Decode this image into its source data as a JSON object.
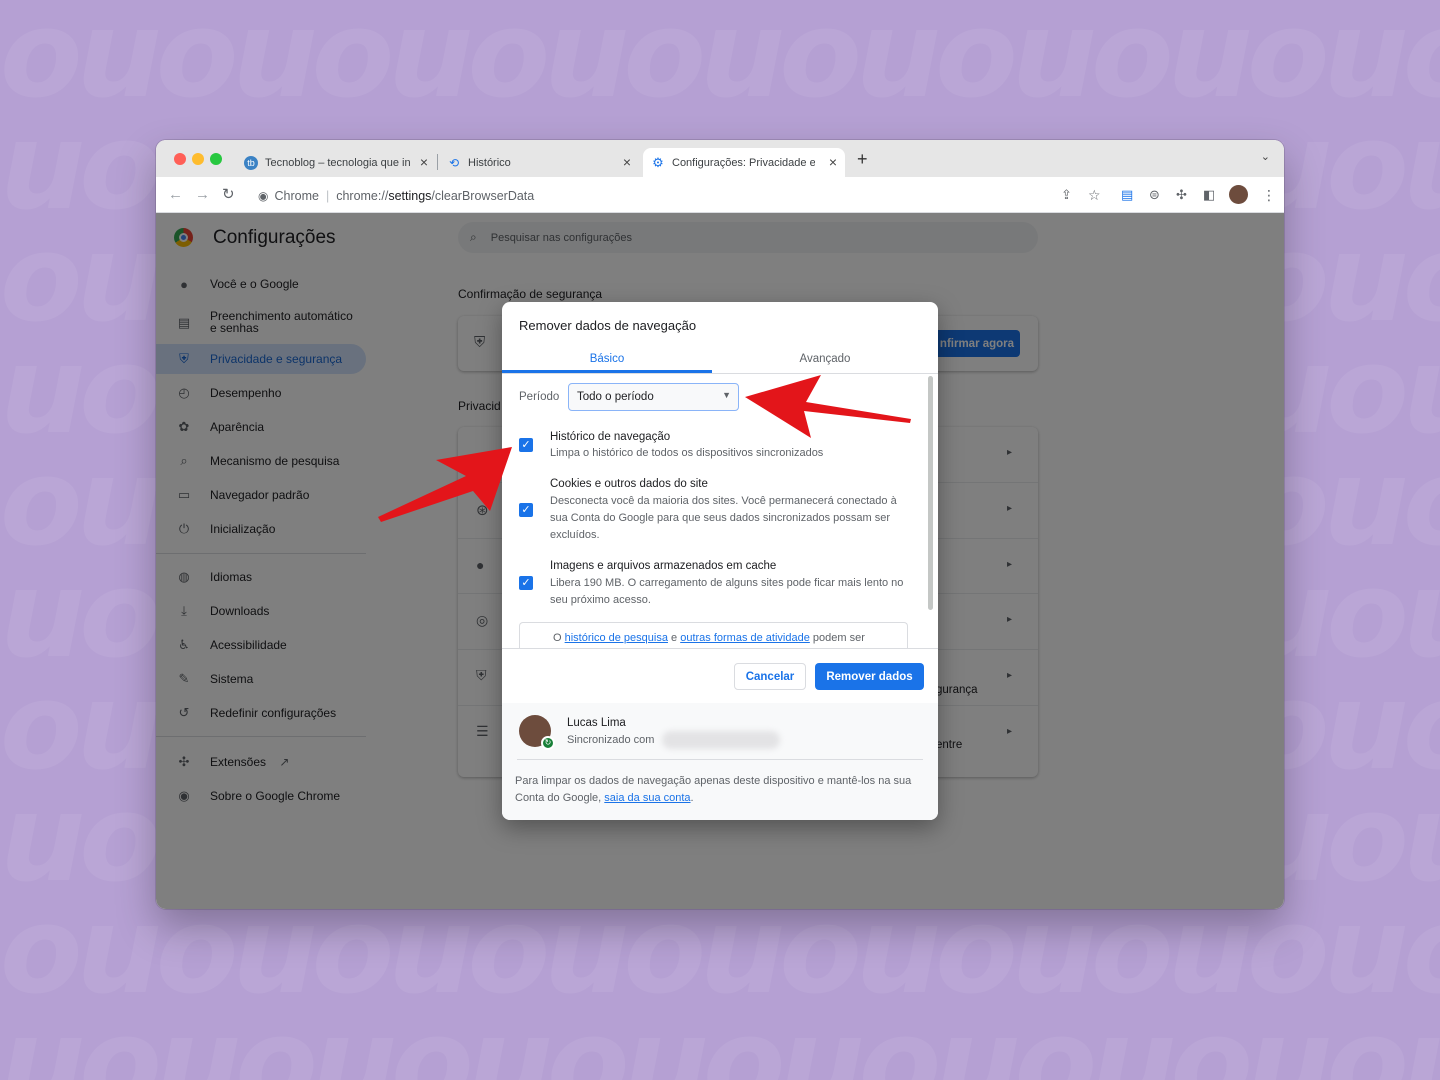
{
  "tabs": [
    {
      "title": "Tecnoblog – tecnologia que in",
      "favicon": "tb"
    },
    {
      "title": "Histórico",
      "favicon": "history-icon"
    },
    {
      "title": "Configurações: Privacidade e",
      "favicon": "gear-icon"
    }
  ],
  "toolbar": {
    "site_chip": "Chrome",
    "url_prefix": "chrome://",
    "url_bold": "settings",
    "url_rest": "/clearBrowserData"
  },
  "settings": {
    "title": "Configurações",
    "search_placeholder": "Pesquisar nas configurações",
    "sidebar": [
      {
        "label": "Você e o Google",
        "icon": "person-icon"
      },
      {
        "label": "Preenchimento automático",
        "label2": "e senhas",
        "icon": "clipboard-icon"
      },
      {
        "label": "Privacidade e segurança",
        "icon": "shield-icon",
        "active": true
      },
      {
        "label": "Desempenho",
        "icon": "speedometer-icon"
      },
      {
        "label": "Aparência",
        "icon": "palette-icon"
      },
      {
        "label": "Mecanismo de pesquisa",
        "icon": "search-icon"
      },
      {
        "label": "Navegador padrão",
        "icon": "browser-icon"
      },
      {
        "label": "Inicialização",
        "icon": "power-icon"
      },
      {
        "label": "Idiomas",
        "icon": "globe-icon"
      },
      {
        "label": "Downloads",
        "icon": "download-icon"
      },
      {
        "label": "Acessibilidade",
        "icon": "accessibility-icon"
      },
      {
        "label": "Sistema",
        "icon": "wrench-icon"
      },
      {
        "label": "Redefinir configurações",
        "icon": "reset-icon"
      },
      {
        "label": "Extensões",
        "icon": "puzzle-icon"
      },
      {
        "label": "Sobre o Google Chrome",
        "icon": "chrome-icon"
      }
    ],
    "safety_heading": "Confirmação de segurança",
    "safety_button": "nfirmar agora",
    "privacy_heading": "Privacid",
    "card_text_1": "gurança",
    "card_text_2": "entre"
  },
  "dialog": {
    "title": "Remover dados de navegação",
    "tab_basic": "Básico",
    "tab_advanced": "Avançado",
    "period_label": "Período",
    "period_value": "Todo o período",
    "options": [
      {
        "title": "Histórico de navegação",
        "desc": "Limpa o histórico de todos os dispositivos sincronizados",
        "checked": true
      },
      {
        "title": "Cookies e outros dados do site",
        "desc": "Desconecta você da maioria dos sites. Você permanecerá conectado à sua Conta do Google para que seus dados sincronizados possam ser excluídos.",
        "checked": true
      },
      {
        "title": "Imagens e arquivos armazenados em cache",
        "desc": "Libera 190 MB. O carregamento de alguns sites pode ficar mais lento no seu próximo acesso.",
        "checked": true
      }
    ],
    "info_pre": "O ",
    "info_link1": "histórico de pesquisa",
    "info_mid": " e ",
    "info_link2": "outras formas de atividade",
    "info_post": " podem ser",
    "cancel": "Cancelar",
    "remove": "Remover dados",
    "account_name": "Lucas Lima",
    "account_sync": "Sincronizado com",
    "footer_text": "Para limpar os dados de navegação apenas deste dispositivo e mantê-los na sua Conta do Google, ",
    "footer_link": "saia da sua conta",
    "footer_end": "."
  },
  "colors": {
    "accent": "#1a73e8",
    "arrow": "#e3151a",
    "background": "#b5a0d3"
  }
}
